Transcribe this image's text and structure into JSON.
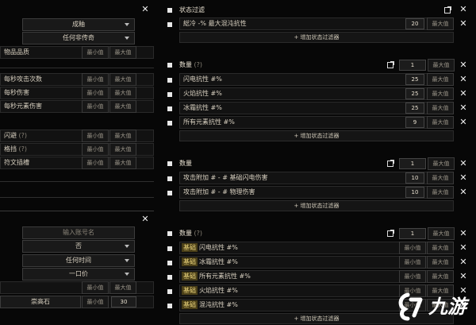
{
  "left_top": {
    "select1": "成釉",
    "select2": "任何非传奇",
    "item_quality": "物品品质",
    "attack_speed": "每秒攻击次数",
    "dps": "每秒伤害",
    "elemental_dps": "每秒元素伤害",
    "evasion": "闪避",
    "block": "格挡",
    "rune_slots": "符文插槽",
    "q_mark": "(?)",
    "min": "最小值",
    "max": "最大值"
  },
  "left_bottom": {
    "account_placeholder": "输入账号名",
    "select_no": "否",
    "select_time": "任何时间",
    "select_price": "一口价",
    "currency": "崇高石",
    "price_value": "30",
    "min": "最小值",
    "max": "最大值"
  },
  "status_filter": {
    "title": "状态过滤",
    "row_text": "総冷 -% 最大混沌抗性",
    "row_value": "20",
    "max": "最大值",
    "add": "+ 增加状态过滤器"
  },
  "count_group1": {
    "title": "数量",
    "q_mark": "(?)",
    "count": "1",
    "max": "最大值",
    "rows": [
      {
        "label": "闪电抗性 #%",
        "value": "25"
      },
      {
        "label": "火焰抗性 #%",
        "value": "25"
      },
      {
        "label": "冰霜抗性 #%",
        "value": "25"
      },
      {
        "label": "所有元素抗性 #%",
        "value": "9"
      }
    ],
    "add": "+ 增加状态过滤器"
  },
  "count_group2": {
    "title": "数量",
    "count": "1",
    "max": "最大值",
    "rows": [
      {
        "label": "攻击附加 # - # 基础闪电伤害",
        "value": "10"
      },
      {
        "label": "攻击附加 # - # 物理伤害",
        "value": "10"
      }
    ],
    "add": "+ 增加状态过滤器"
  },
  "count_group3": {
    "title": "数量",
    "q_mark": "(?)",
    "count": "1",
    "max": "最大值",
    "min": "最小值",
    "tag": "基础",
    "rows": [
      {
        "label": "闪电抗性 #%"
      },
      {
        "label": "冰霜抗性 #%"
      },
      {
        "label": "所有元素抗性 #%"
      },
      {
        "label": "火焰抗性 #%"
      },
      {
        "label": "混沌抗性 #%"
      }
    ],
    "add": "+ 增加状态过滤器"
  },
  "watermark": {
    "text": "九游"
  },
  "colors": {
    "background": "#070707",
    "tag_bg": "#4a3f18",
    "text": "#d8d0c0"
  }
}
